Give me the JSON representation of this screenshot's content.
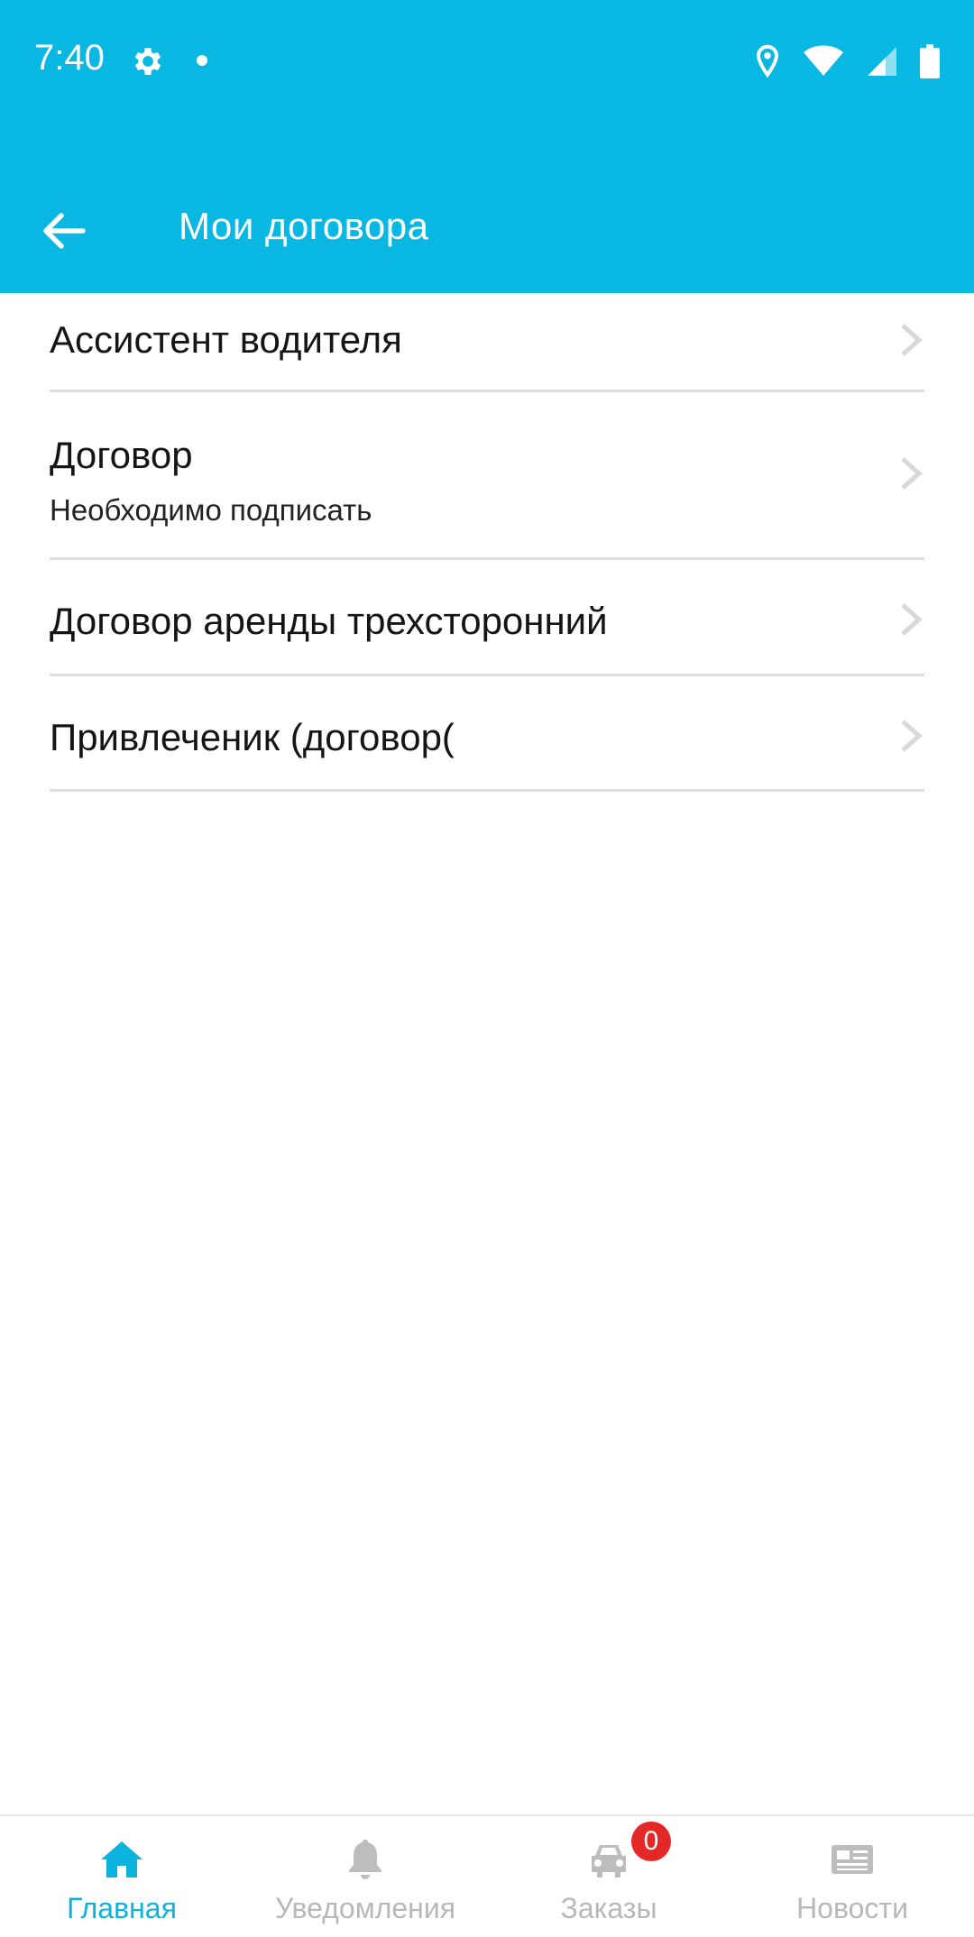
{
  "status_bar": {
    "time": "7:40",
    "icons": [
      "gear-icon",
      "dot-icon",
      "location-icon",
      "wifi-icon",
      "cell-signal-icon",
      "battery-icon"
    ]
  },
  "toolbar": {
    "title": "Мои договора",
    "back_icon": "arrow-left-icon"
  },
  "contracts": [
    {
      "title": "Ассистент водителя",
      "subtitle": ""
    },
    {
      "title": "Договор",
      "subtitle": "Необходимо подписать"
    },
    {
      "title": "Договор аренды трехсторонний",
      "subtitle": ""
    },
    {
      "title": "Привлеченик (договор(",
      "subtitle": ""
    }
  ],
  "bottom_nav": {
    "items": [
      {
        "label": "Главная",
        "icon": "home-icon",
        "active": true
      },
      {
        "label": "Уведомления",
        "icon": "bell-icon",
        "active": false
      },
      {
        "label": "Заказы",
        "icon": "car-icon",
        "active": false,
        "badge": "0"
      },
      {
        "label": "Новости",
        "icon": "newspaper-icon",
        "active": false
      }
    ]
  },
  "colors": {
    "primary": "#08b8e3",
    "active_nav": "#0bb3dd",
    "inactive_nav": "#b8b8b8",
    "badge": "#e42727",
    "divider": "#dcdcdc"
  }
}
